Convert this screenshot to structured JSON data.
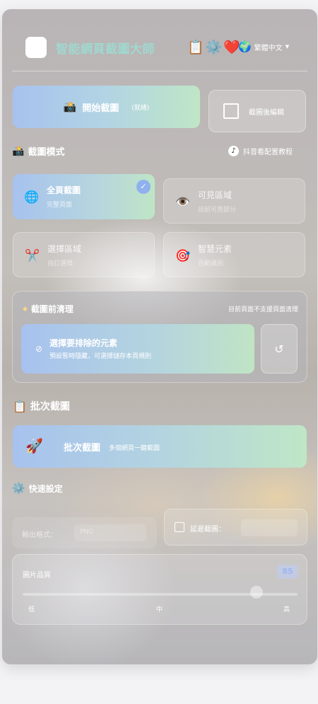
{
  "header": {
    "title": "智能網頁截圖大師",
    "icons": [
      "clipboard-icon",
      "gear-icon",
      "heart-icon"
    ],
    "language": "繁體中文"
  },
  "actions": {
    "start_label": "開始截圖",
    "start_status": "(就緒)",
    "edit_after_label": "截圖後編輯"
  },
  "capture_mode": {
    "title": "截圖模式",
    "tutorial_link": "抖音看配置教程",
    "modes": [
      {
        "name": "全頁截圖",
        "desc": "完整頁面",
        "active": true
      },
      {
        "name": "可見區域",
        "desc": "目前可見部分",
        "active": false
      },
      {
        "name": "選擇區域",
        "desc": "自訂選擇",
        "active": false
      },
      {
        "name": "智慧元素",
        "desc": "自動識別",
        "active": false
      }
    ]
  },
  "cleanup": {
    "title": "截圖前清理",
    "note": "目前頁面不支援頁面清理",
    "exclude_title": "選擇要排除的元素",
    "exclude_desc": "預設暫時隱藏，可選擇儲存本頁規則"
  },
  "batch": {
    "section_title": "批次截圖",
    "button_label": "批次截圖",
    "button_desc": "多個網頁一鍵截圖"
  },
  "quick_settings": {
    "title": "快速設定",
    "format_label": "輸出格式：",
    "format_value": "PNG",
    "delay_label": "延遲截圖：",
    "quality_label": "圖片品質",
    "quality_value": "85",
    "quality_fraction": 0.85,
    "ticks": [
      "低",
      "中",
      "高"
    ]
  }
}
